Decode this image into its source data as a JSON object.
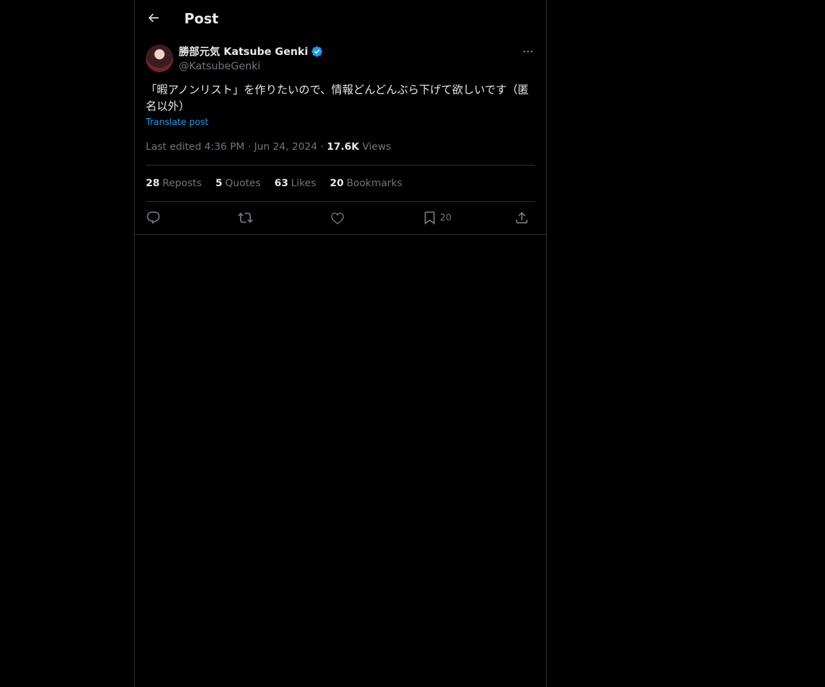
{
  "header": {
    "title": "Post"
  },
  "author": {
    "name": "勝部元気 Katsube Genki",
    "handle": "@KatsubeGenki"
  },
  "post": {
    "text": "「暇アノンリスト」を作りたいので、情報どんどんぶら下げて欲しいです（匿名以外）",
    "translate_label": "Translate post",
    "edited_label": "Last edited 4:36 PM",
    "date": "Jun 24, 2024",
    "views_count": "17.6K",
    "views_label": "Views"
  },
  "stats": {
    "reposts": {
      "count": "28",
      "label": "Reposts"
    },
    "quotes": {
      "count": "5",
      "label": "Quotes"
    },
    "likes": {
      "count": "63",
      "label": "Likes"
    },
    "bookmarks": {
      "count": "20",
      "label": "Bookmarks"
    }
  },
  "actions": {
    "bookmark_count": "20"
  },
  "colors": {
    "background": "#000000",
    "text": "#e7e9ea",
    "secondary": "#71767b",
    "accent": "#1d9bf0",
    "border": "#2f3336"
  },
  "icons": [
    "arrow-left-icon",
    "verified-badge-icon",
    "more-icon",
    "reply-icon",
    "repost-icon",
    "like-icon",
    "bookmark-icon",
    "share-icon"
  ]
}
